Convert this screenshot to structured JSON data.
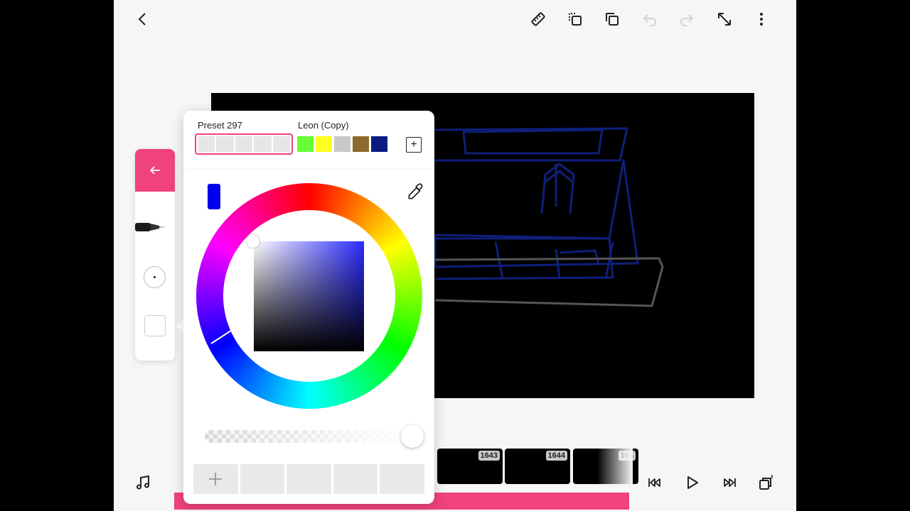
{
  "toolbar": {
    "back": "chevron-left-icon",
    "ruler": "ruler-icon",
    "copy": "copy-layer-icon",
    "duplicate": "duplicate-icon",
    "undo": "undo-icon",
    "redo": "redo-icon",
    "expand": "expand-icon",
    "more": "more-icon"
  },
  "timeline": {
    "frames": [
      {
        "number": "1643"
      },
      {
        "number": "1644"
      },
      {
        "number": "164"
      }
    ],
    "accent_color": "#f0437b"
  },
  "tool_panel": {
    "accent_color": "#f0437b"
  },
  "color_picker": {
    "preset_a": {
      "label": "Preset 297",
      "swatches": [
        "#e6e6e6",
        "#e6e6e6",
        "#e6e6e6",
        "#e6e6e6",
        "#e6e6e6"
      ]
    },
    "preset_b": {
      "label": "Leon (Copy)",
      "swatches": [
        "#66ff33",
        "#ffff22",
        "#c8c8c8",
        "#8b6a2f",
        "#0a1a80"
      ]
    },
    "current_color": "#0000ee",
    "hue": "#2b2bff",
    "add_slot_label": "+"
  }
}
